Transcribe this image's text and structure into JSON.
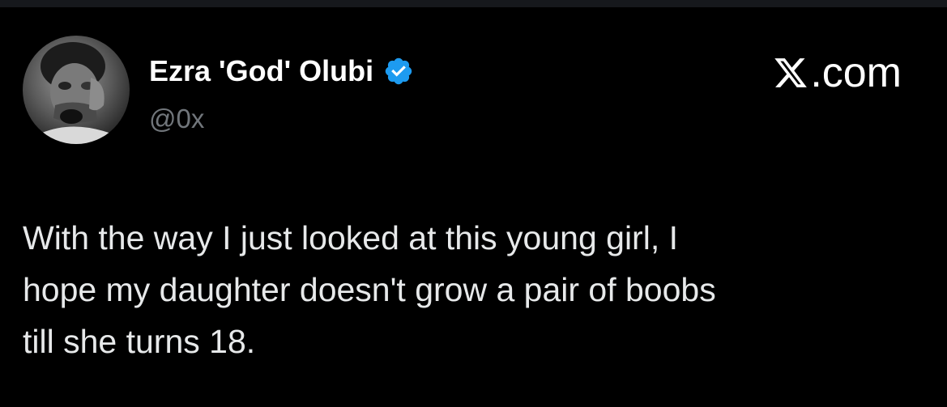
{
  "author": {
    "name": "Ezra 'God' Olubi",
    "handle": "@0x",
    "verified": true
  },
  "brand": {
    "suffix": ".com"
  },
  "tweet": {
    "text": "With the way I just looked at this young girl, I\nhope my daughter doesn't grow a pair of boobs\ntill she turns 18."
  },
  "colors": {
    "background": "#000000",
    "text": "#e7e9ea",
    "muted": "#71767b",
    "verified": "#1d9bf0"
  },
  "icons": {
    "avatar": "avatar-photo",
    "verified": "verified-badge-icon",
    "brand": "x-logo-icon"
  }
}
